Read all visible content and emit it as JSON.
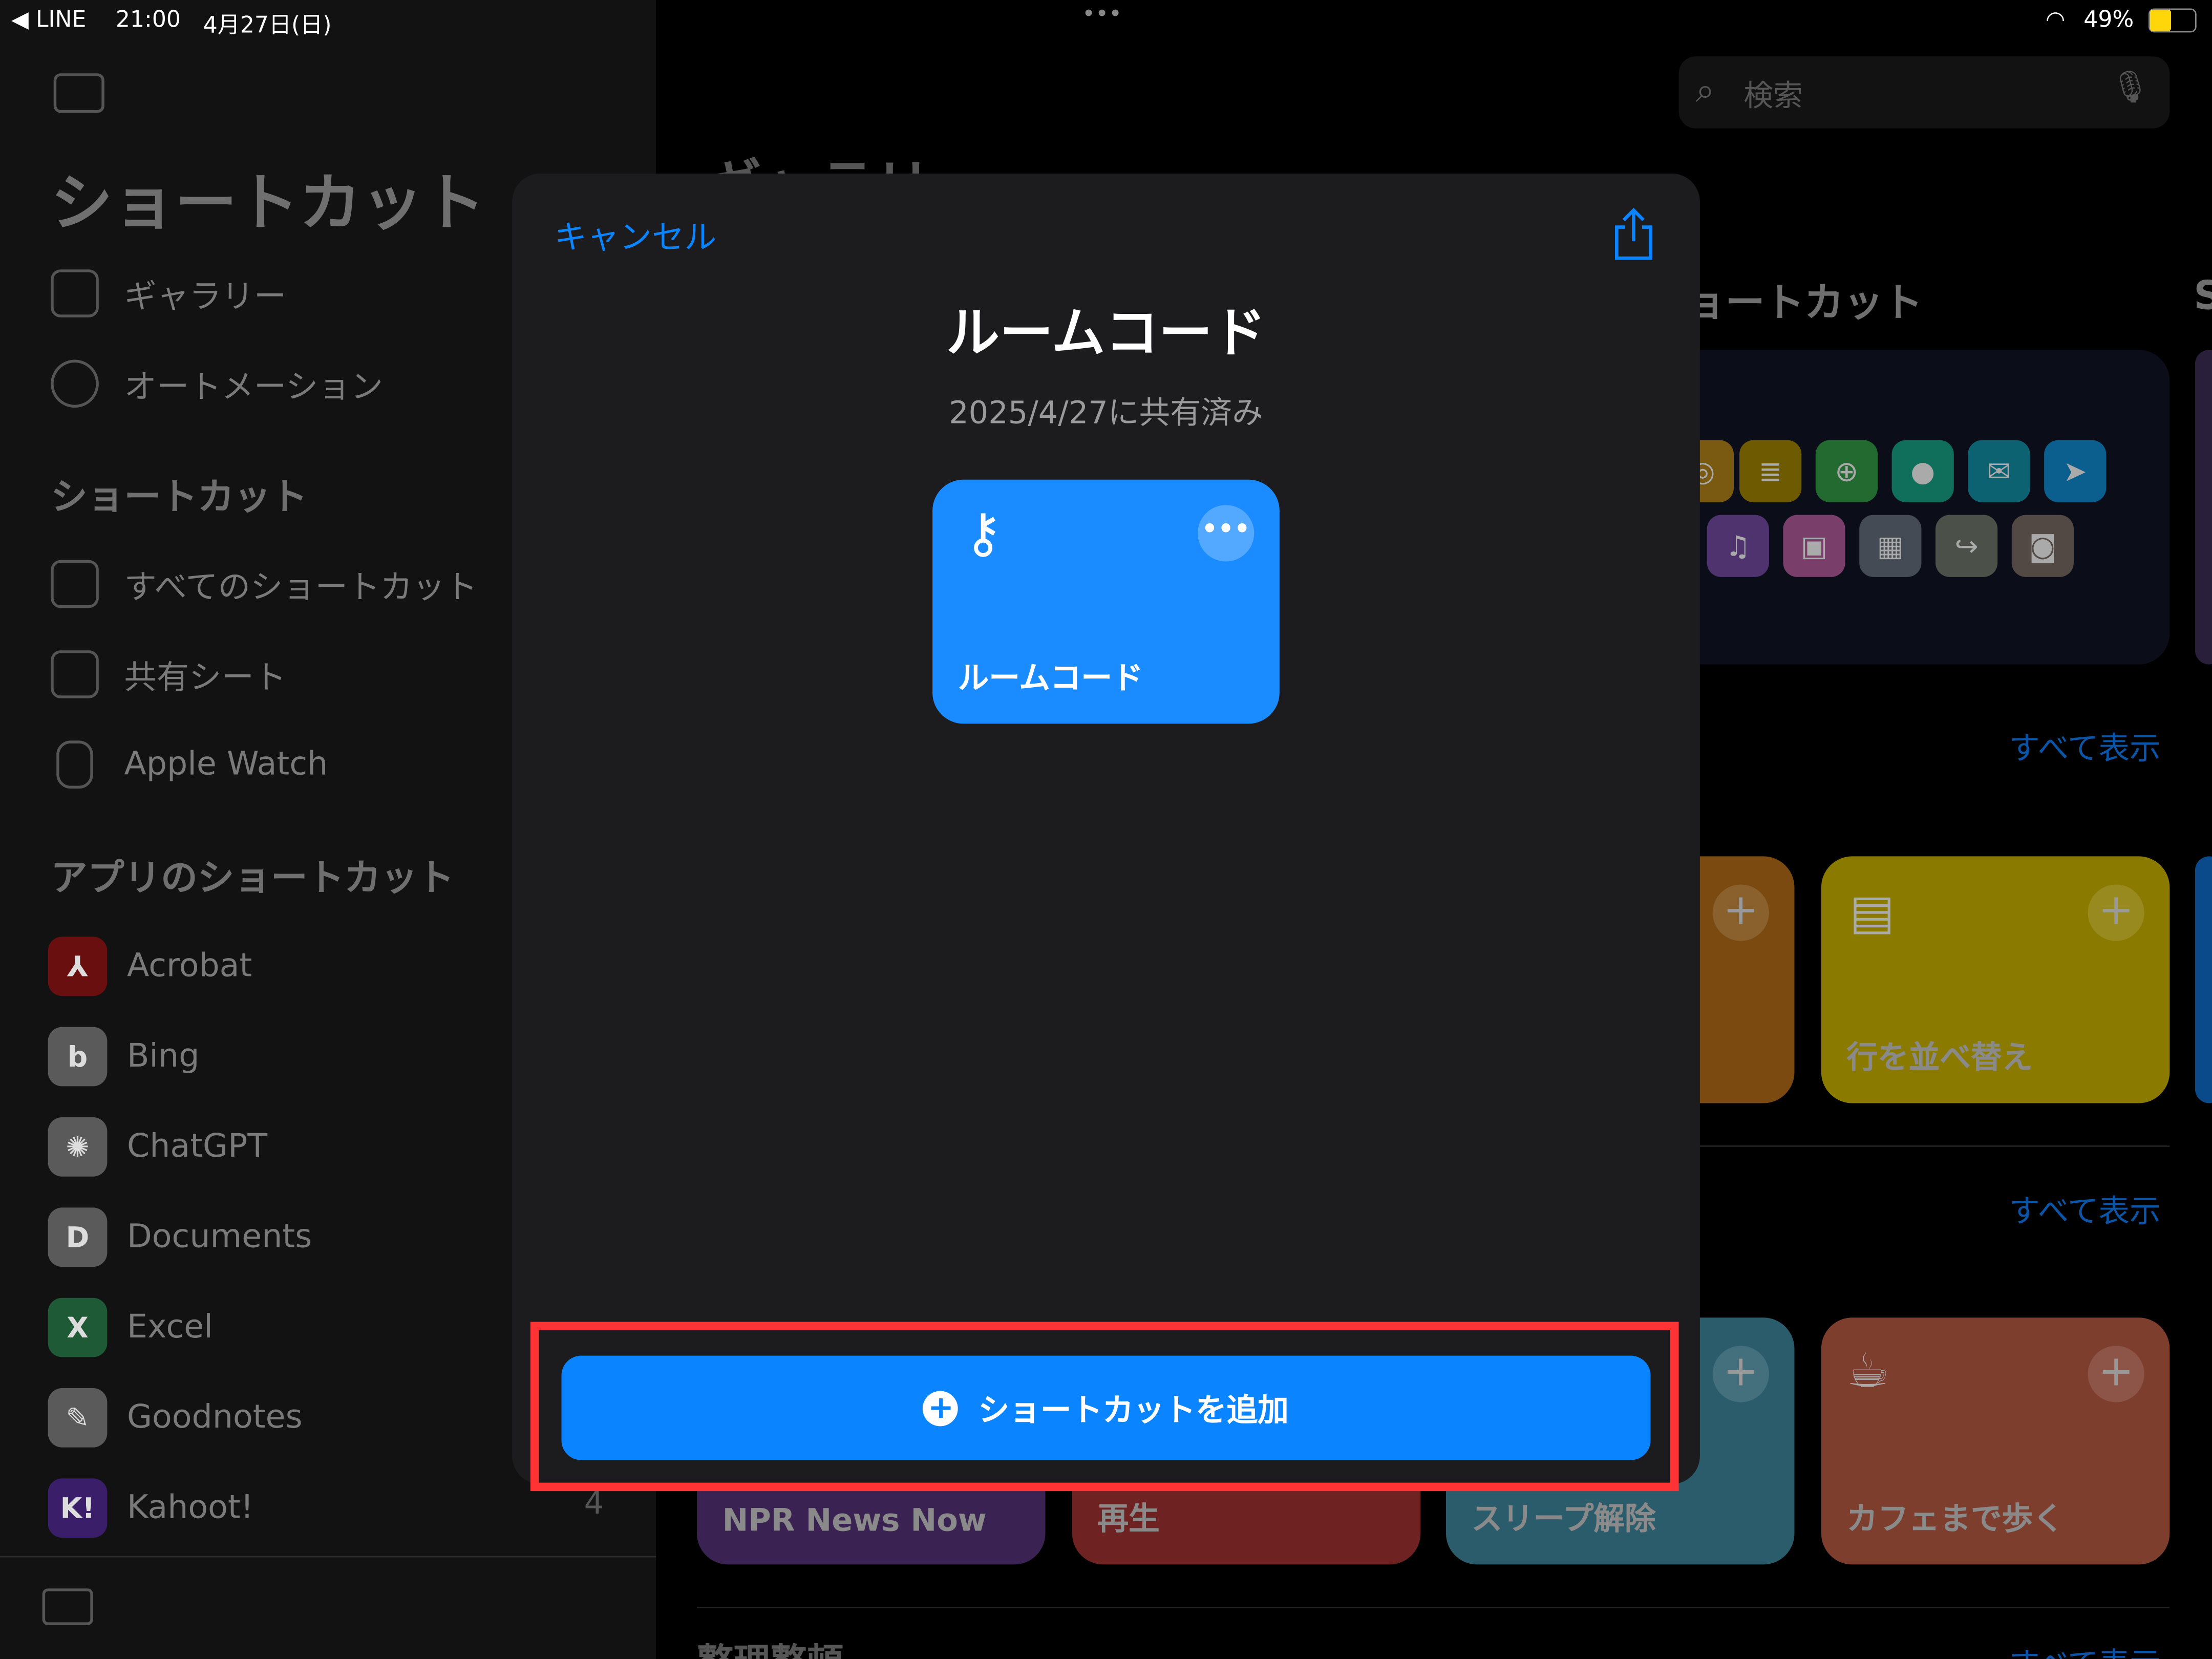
{
  "status_bar": {
    "back_app": "◀ LINE",
    "time": "21:00",
    "date": "4月27日(日)",
    "battery": "49%",
    "dots": "•••"
  },
  "sidebar": {
    "title": "ショートカット",
    "items": [
      {
        "label": "ギャラリー"
      },
      {
        "label": "オートメーション"
      }
    ],
    "section_shortcuts": "ショートカット",
    "shortcut_items": [
      {
        "label": "すべてのショートカット"
      },
      {
        "label": "共有シート"
      },
      {
        "label": "Apple Watch"
      }
    ],
    "section_apps": "アプリのショートカット",
    "apps": [
      {
        "label": "Acrobat",
        "glyph": "⅄",
        "color": "#6a0f0f"
      },
      {
        "label": "Bing",
        "glyph": "b",
        "color": "#5a5a5a"
      },
      {
        "label": "ChatGPT",
        "glyph": "✺",
        "color": "#5a5a5a"
      },
      {
        "label": "Documents",
        "glyph": "D",
        "color": "#5a5a5a"
      },
      {
        "label": "Excel",
        "glyph": "X",
        "color": "#1d5a35"
      },
      {
        "label": "Goodnotes",
        "glyph": "✎",
        "color": "#5a5a5a"
      },
      {
        "label": "Kahoot!",
        "glyph": "K!",
        "color": "#3a1e6a"
      }
    ],
    "kahoot_count": "4"
  },
  "main": {
    "search_placeholder": "検索",
    "gallery_heading_partial": "ギャラリー",
    "starter_heading": "ョートカット",
    "starter_heading_next": "S",
    "see_all_1": "すべて表示",
    "see_all_2": "すべて表示",
    "see_all_3": "すべて表示",
    "tiles_row1": [
      {
        "label": "行を並べ替え",
        "color": "#8a7a00"
      }
    ],
    "tiles_row2": [
      {
        "label": "NPR News Now",
        "color": "#3a2352"
      },
      {
        "label": "再生",
        "color": "#6e2222"
      },
      {
        "label": "スリープ解除",
        "color": "#2b5c6b"
      },
      {
        "label": "カフェまで歩く",
        "color": "#7e3e2e"
      }
    ],
    "bottom_heading": "整理整頓"
  },
  "modal": {
    "cancel": "キャンセル",
    "title": "ルームコード",
    "subtitle": "2025/4/27に共有済み",
    "card_label": "ルームコード",
    "card_color": "#1a8cff",
    "add_button": "ショートカットを追加",
    "highlight_color": "#ff3333"
  }
}
